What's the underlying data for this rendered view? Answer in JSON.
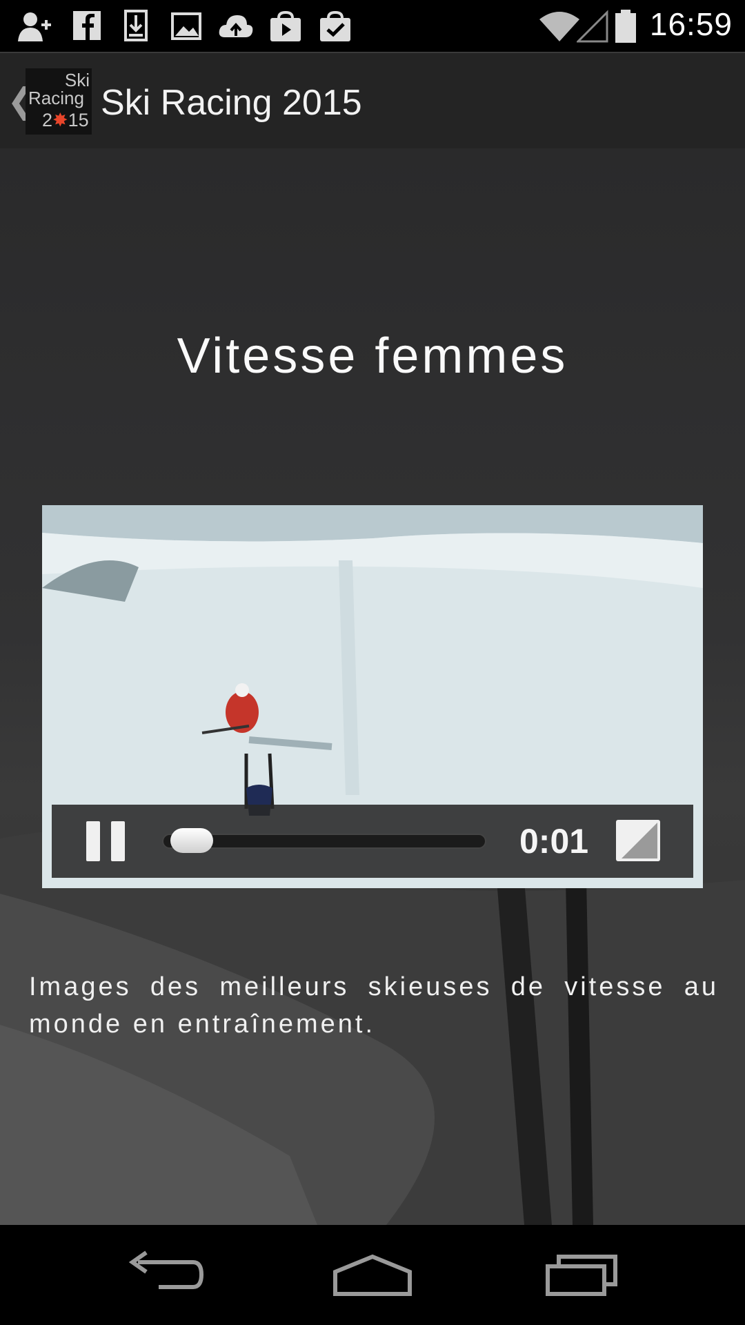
{
  "status_bar": {
    "time": "16:59",
    "icons": [
      "add-contact-icon",
      "facebook-icon",
      "download-icon",
      "image-icon",
      "cloud-upload-icon",
      "play-store-icon",
      "clipboard-check-icon",
      "wifi-icon",
      "signal-icon",
      "battery-icon"
    ]
  },
  "action_bar": {
    "title": "Ski Racing 2015",
    "logo_line1": "Ski",
    "logo_line2": "Racing",
    "logo_line3_a": "2",
    "logo_line3_b": "15"
  },
  "main": {
    "video_title": "Vitesse femmes",
    "description": "Images des meilleurs skieuses de vitesse au monde en entraînement."
  },
  "player": {
    "elapsed": "0:01",
    "progress_fraction": 0.03,
    "state": "playing"
  },
  "colors": {
    "action_bar_bg": "#242424",
    "logo_leaf": "#e8452a"
  }
}
